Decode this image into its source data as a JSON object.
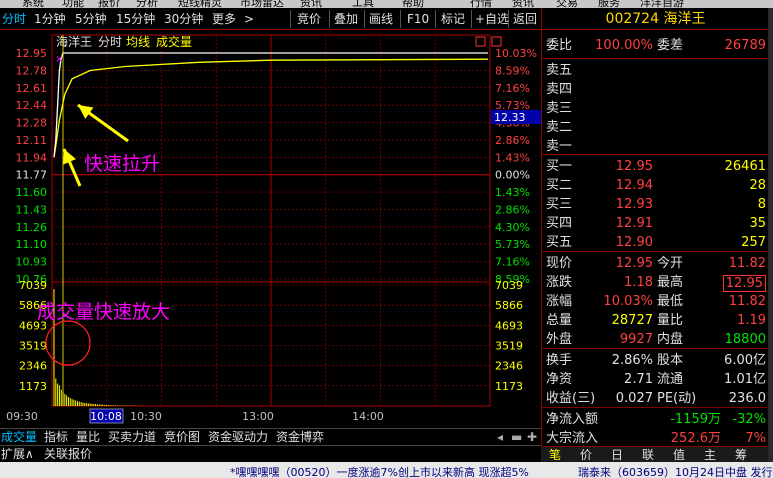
{
  "top_menu": [
    "系统",
    "功能",
    "报价",
    "分析",
    "短线精灵",
    "市场雷达",
    "资讯",
    "工具",
    "帮助",
    "行情",
    "资讯",
    "交易",
    "服务",
    "洋洋自游"
  ],
  "toolbar": {
    "left": [
      "分时",
      "1分钟",
      "5分钟",
      "15分钟",
      "30分钟",
      "更多",
      ">"
    ],
    "right": [
      "竞价",
      "叠加",
      "画线",
      "F10",
      "标记",
      "+自选",
      "返回"
    ]
  },
  "chart_header": {
    "stock_name": "海洋王",
    "mode": "分时",
    "avg_line_label": "均线",
    "volume_label": "成交量",
    "marker": "×"
  },
  "annotations": {
    "price_rise": "快速拉升",
    "volume_expand": "成交量快速放大"
  },
  "cursor_price": "12.33",
  "cursor_time": "10:08",
  "chart_data": {
    "type": "line",
    "price_axis": {
      "ticks": [
        "12.95",
        "12.78",
        "12.61",
        "12.44",
        "12.28",
        "12.11",
        "11.94",
        "11.77",
        "11.60",
        "11.43",
        "11.26",
        "11.10",
        "10.93",
        "10.76"
      ],
      "pct_ticks": [
        "10.03%",
        "8.59%",
        "7.16%",
        "5.73%",
        "4.30%",
        "2.86%",
        "1.43%",
        "0.00%",
        "1.43%",
        "2.86%",
        "4.30%",
        "5.73%",
        "7.16%",
        "8.59%"
      ],
      "ylim": [
        10.76,
        12.95
      ],
      "prev_close": 11.77
    },
    "volume_axis": {
      "ticks": [
        "7039",
        "5866",
        "4693",
        "3519",
        "2346",
        "1173"
      ],
      "ylim": [
        0,
        7039
      ]
    },
    "time_axis": {
      "labels": [
        "09:30",
        "10:30",
        "13:00",
        "14:00"
      ]
    },
    "price_series": {
      "name": "价格",
      "points": [
        [
          0,
          11.94
        ],
        [
          1,
          12.11
        ],
        [
          2,
          12.44
        ],
        [
          3,
          12.78
        ],
        [
          4,
          12.9
        ],
        [
          5,
          12.95
        ],
        [
          30,
          12.95
        ],
        [
          120,
          12.95
        ],
        [
          240,
          12.95
        ]
      ]
    },
    "avg_series": {
      "name": "均线",
      "points": [
        [
          0,
          11.94
        ],
        [
          1,
          12.05
        ],
        [
          3,
          12.3
        ],
        [
          6,
          12.55
        ],
        [
          10,
          12.7
        ],
        [
          20,
          12.78
        ],
        [
          40,
          12.82
        ],
        [
          80,
          12.86
        ],
        [
          120,
          12.88
        ],
        [
          240,
          12.89
        ]
      ]
    },
    "volume_series": {
      "name": "成交量",
      "values": [
        6800,
        1600,
        1300,
        1200,
        950,
        800,
        700,
        620,
        520,
        460,
        400,
        360,
        320,
        280,
        250,
        220,
        200,
        180,
        160,
        150,
        140,
        130,
        120,
        110,
        100,
        90,
        85,
        80,
        70,
        60,
        55,
        50,
        45,
        40,
        40,
        35,
        30,
        30,
        25,
        25,
        20,
        20,
        20,
        18,
        15,
        15,
        12,
        12,
        10,
        10
      ]
    }
  },
  "bottom_tabs": [
    "成交量",
    "指标",
    "量比",
    "买卖力道",
    "竞价图",
    "资金驱动力",
    "资金博弈"
  ],
  "bottom_tabs2": [
    "扩展∧",
    "关联报价"
  ],
  "ticker_text": [
    "*嘿嘿嘿嘿（00520）一度涨逾7%创上市以来新高 现涨超5%",
    "瑞泰来（603659）10月24日中盘 发行"
  ],
  "quote": {
    "code": "002724",
    "name": "海洋王",
    "weibi_label": "委比",
    "weibi": "100.00%",
    "weicha_label": "委差",
    "weicha": "26789",
    "sell": [
      {
        "label": "卖五",
        "price": "",
        "vol": ""
      },
      {
        "label": "卖四",
        "price": "",
        "vol": ""
      },
      {
        "label": "卖三",
        "price": "",
        "vol": ""
      },
      {
        "label": "卖二",
        "price": "",
        "vol": ""
      },
      {
        "label": "卖一",
        "price": "",
        "vol": ""
      }
    ],
    "buy": [
      {
        "label": "买一",
        "price": "12.95",
        "vol": "26461"
      },
      {
        "label": "买二",
        "price": "12.94",
        "vol": "28"
      },
      {
        "label": "买三",
        "price": "12.93",
        "vol": "8"
      },
      {
        "label": "买四",
        "price": "12.91",
        "vol": "35"
      },
      {
        "label": "买五",
        "price": "12.90",
        "vol": "257"
      }
    ],
    "stats": [
      {
        "l1": "现价",
        "v1": "12.95",
        "c1": "red",
        "l2": "今开",
        "v2": "11.82",
        "c2": "red"
      },
      {
        "l1": "涨跌",
        "v1": "1.18",
        "c1": "red",
        "l2": "最高",
        "v2": "12.95",
        "c2": "red"
      },
      {
        "l1": "涨幅",
        "v1": "10.03%",
        "c1": "red",
        "l2": "最低",
        "v2": "11.82",
        "c2": "red"
      },
      {
        "l1": "总量",
        "v1": "28727",
        "c1": "yellow",
        "l2": "量比",
        "v2": "1.19",
        "c2": "red"
      },
      {
        "l1": "外盘",
        "v1": "9927",
        "c1": "red",
        "l2": "内盘",
        "v2": "18800",
        "c2": "green"
      }
    ],
    "stats2": [
      {
        "l1": "换手",
        "v1": "2.86%",
        "l2": "股本",
        "v2": "6.00亿"
      },
      {
        "l1": "净资",
        "v1": "2.71",
        "l2": "流通",
        "v2": "1.01亿"
      },
      {
        "l1": "收益(三)",
        "v1": "0.027",
        "l2": "PE(动)",
        "v2": "236.0"
      }
    ],
    "flow": [
      {
        "label": "净流入额",
        "value": "-1159万",
        "pct": "-32%",
        "c1": "green",
        "c2": "green"
      },
      {
        "label": "大宗流入",
        "value": "252.6万",
        "pct": "7%",
        "c1": "red",
        "c2": "red"
      }
    ]
  },
  "right_tabs": [
    "笔",
    "价",
    "日",
    "联",
    "值",
    "主",
    "筹"
  ],
  "colors": {
    "price_line": "#ffffff",
    "avg_line": "#ffff00",
    "volume": "#ffff00",
    "up": "#ff4040",
    "down": "#00e000",
    "annotation": "#ff00ff",
    "arrow": "#ffff00",
    "grid": "#aa0000"
  }
}
